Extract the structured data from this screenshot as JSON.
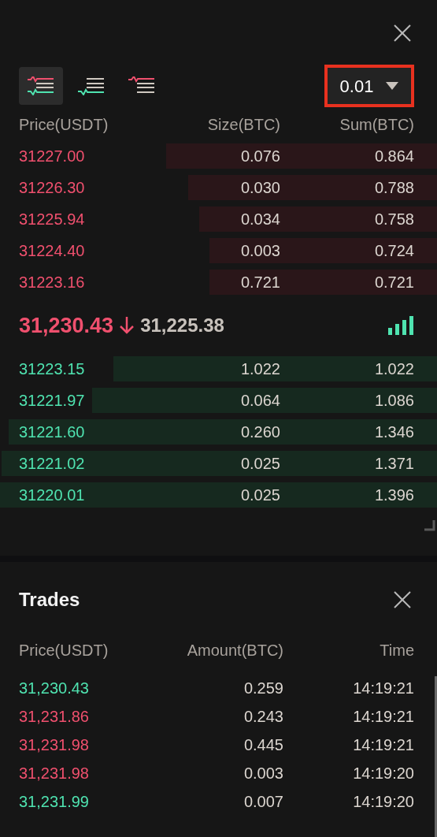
{
  "order_book": {
    "view_modes": [
      {
        "kind": "both",
        "selected": true
      },
      {
        "kind": "bids",
        "selected": false
      },
      {
        "kind": "asks",
        "selected": false
      }
    ],
    "precision": {
      "value": "0.01",
      "highlighted": true
    },
    "columns": [
      "Price(USDT)",
      "Size(BTC)",
      "Sum(BTC)"
    ],
    "asks": [
      {
        "price": "31227.00",
        "size": "0.076",
        "sum": "0.864"
      },
      {
        "price": "31226.30",
        "size": "0.030",
        "sum": "0.788"
      },
      {
        "price": "31225.94",
        "size": "0.034",
        "sum": "0.758"
      },
      {
        "price": "31224.40",
        "size": "0.003",
        "sum": "0.724"
      },
      {
        "price": "31223.16",
        "size": "0.721",
        "sum": "0.721"
      }
    ],
    "last_price": {
      "price": "31,230.43",
      "falling": true,
      "mark_price": "31,225.38"
    },
    "bids": [
      {
        "price": "31223.15",
        "size": "1.022",
        "sum": "1.022"
      },
      {
        "price": "31221.97",
        "size": "0.064",
        "sum": "1.086"
      },
      {
        "price": "31221.60",
        "size": "0.260",
        "sum": "1.346"
      },
      {
        "price": "31221.02",
        "size": "0.025",
        "sum": "1.371"
      },
      {
        "price": "31220.01",
        "size": "0.025",
        "sum": "1.396"
      }
    ]
  },
  "trades": {
    "title": "Trades",
    "columns": [
      "Price(USDT)",
      "Amount(BTC)",
      "Time"
    ],
    "rows": [
      {
        "price": "31,230.43",
        "amount": "0.259",
        "time": "14:19:21",
        "color": "#4fe3b0"
      },
      {
        "price": "31,231.86",
        "amount": "0.243",
        "time": "14:19:21",
        "color": "#f0506e"
      },
      {
        "price": "31,231.98",
        "amount": "0.445",
        "time": "14:19:21",
        "color": "#f0506e"
      },
      {
        "price": "31,231.98",
        "amount": "0.003",
        "time": "14:19:20",
        "color": "#f0506e"
      },
      {
        "price": "31,231.99",
        "amount": "0.007",
        "time": "14:19:20",
        "color": "#4fe3b0"
      }
    ]
  }
}
